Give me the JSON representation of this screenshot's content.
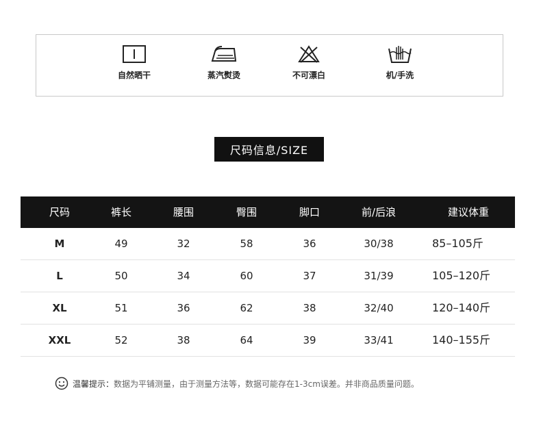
{
  "care": [
    {
      "icon": "tumble-dry-icon",
      "label": "自然晒干"
    },
    {
      "icon": "iron-icon",
      "label": "蒸汽熨烫"
    },
    {
      "icon": "no-bleach-icon",
      "label": "不可漂白"
    },
    {
      "icon": "hand-wash-icon",
      "label": "机/手洗"
    }
  ],
  "title": "尺码信息/SIZE",
  "table": {
    "headers": [
      "尺码",
      "裤长",
      "腰围",
      "臀围",
      "脚口",
      "前/后浪",
      "建议体重"
    ],
    "rows": [
      [
        "M",
        "49",
        "32",
        "58",
        "36",
        "30/38",
        "85–105斤"
      ],
      [
        "L",
        "50",
        "34",
        "60",
        "37",
        "31/39",
        "105–120斤"
      ],
      [
        "XL",
        "51",
        "36",
        "62",
        "38",
        "32/40",
        "120–140斤"
      ],
      [
        "XXL",
        "52",
        "38",
        "64",
        "39",
        "33/41",
        "140–155斤"
      ]
    ]
  },
  "note": {
    "icon": "smiley-icon",
    "label": "温馨提示：",
    "text": "数据为平铺测量，由于测量方法等，数据可能存在1-3cm误差。并非商品质量问题。"
  }
}
